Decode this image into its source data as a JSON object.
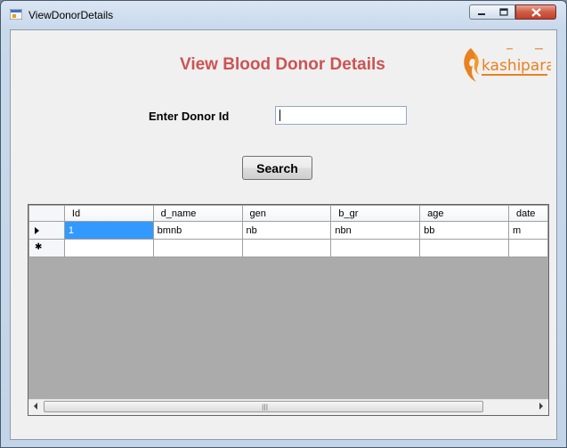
{
  "window": {
    "title": "ViewDonorDetails"
  },
  "heading": "View Blood Donor Details",
  "form": {
    "donor_id_label": "Enter Donor Id",
    "donor_id_value": "",
    "search_label": "Search"
  },
  "grid": {
    "columns": [
      "Id",
      "d_name",
      "gen",
      "b_gr",
      "age",
      "date"
    ],
    "rows": [
      [
        "1",
        "bmnb",
        "nb",
        "nbn",
        "bb",
        "m"
      ]
    ],
    "scrollbar_grip": "|||"
  },
  "colors": {
    "heading": "#cd5353",
    "selection": "#3399ff",
    "grid_background": "#ababab",
    "close_button": "#c0422b"
  },
  "icons": [
    "app-icon",
    "minimize-icon",
    "maximize-icon",
    "close-icon",
    "row-pointer-icon",
    "new-row-icon",
    "scroll-left-icon",
    "scroll-right-icon",
    "kashipara-logo"
  ]
}
